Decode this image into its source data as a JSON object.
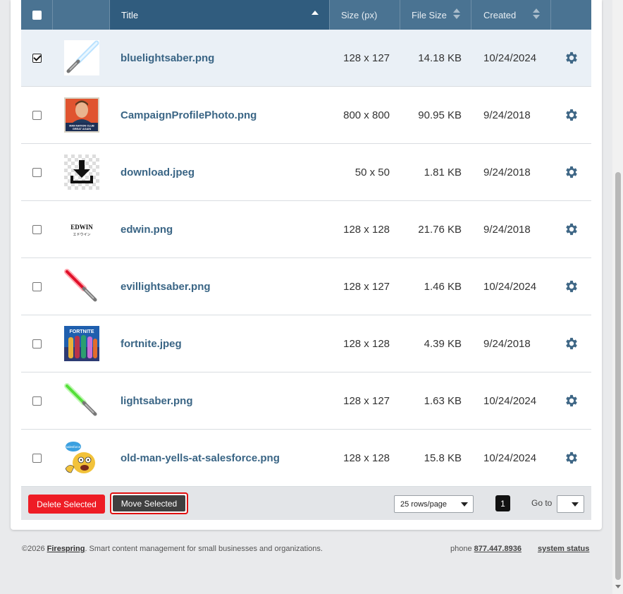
{
  "table": {
    "columns": {
      "title": "Title",
      "size": "Size (px)",
      "file_size": "File Size",
      "created": "Created"
    },
    "rows": [
      {
        "title": "bluelightsaber.png",
        "size": "128 x 127",
        "file_size": "14.18 KB",
        "created": "10/24/2024",
        "selected": true,
        "thumb": "blue-lightsaber"
      },
      {
        "title": "CampaignProfilePhoto.png",
        "size": "800 x 800",
        "file_size": "90.95 KB",
        "created": "9/24/2018",
        "selected": false,
        "thumb": "campaign-photo"
      },
      {
        "title": "download.jpeg",
        "size": "50 x 50",
        "file_size": "1.81 KB",
        "created": "9/24/2018",
        "selected": false,
        "thumb": "download-icon"
      },
      {
        "title": "edwin.png",
        "size": "128 x 128",
        "file_size": "21.76 KB",
        "created": "9/24/2018",
        "selected": false,
        "thumb": "edwin-logo"
      },
      {
        "title": "evillightsaber.png",
        "size": "128 x 127",
        "file_size": "1.46 KB",
        "created": "10/24/2024",
        "selected": false,
        "thumb": "red-lightsaber"
      },
      {
        "title": "fortnite.jpeg",
        "size": "128 x 128",
        "file_size": "4.39 KB",
        "created": "9/24/2018",
        "selected": false,
        "thumb": "fortnite-art"
      },
      {
        "title": "lightsaber.png",
        "size": "128 x 127",
        "file_size": "1.63 KB",
        "created": "10/24/2024",
        "selected": false,
        "thumb": "green-lightsaber"
      },
      {
        "title": "old-man-yells-at-salesforce.png",
        "size": "128 x 128",
        "file_size": "15.8 KB",
        "created": "10/24/2024",
        "selected": false,
        "thumb": "old-man-cartoon"
      }
    ]
  },
  "thumb_text": {
    "campaign_banner": "MAN NATION CLUB",
    "campaign_banner2": "GREAT AGAIN",
    "edwin": "EDWIN",
    "edwin_sub": "エドウイン",
    "fortnite": "FORTNITE",
    "salesforce": "salesforce"
  },
  "footer_bar": {
    "delete_label": "Delete Selected",
    "move_label": "Move Selected",
    "rows_per_page": "25 rows/page",
    "current_page": "1",
    "goto_label": "Go to"
  },
  "page_footer": {
    "copyright_prefix": "©2026 ",
    "brand": "Firespring",
    "tagline": ". Smart content management for small businesses and organizations.",
    "phone_label": "phone ",
    "phone_number": "877.447.8936",
    "system_status": "system status"
  },
  "colors": {
    "header_bg": "#4a7392",
    "header_sorted_bg": "#305c7e",
    "title_link": "#3a6585",
    "delete_button": "#ee1c25",
    "move_button": "#3f3f3f",
    "move_button_outline": "#e01010"
  }
}
